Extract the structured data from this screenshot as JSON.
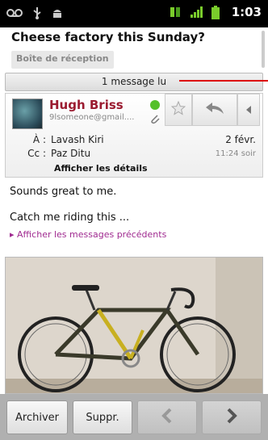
{
  "status_bar": {
    "time": "1:03",
    "left_icons": [
      "voicemail-icon",
      "usb-icon",
      "android-icon"
    ],
    "right_icons": [
      "data-sync-icon",
      "signal-icon",
      "battery-icon"
    ]
  },
  "header": {
    "subject": "Cheese factory this Sunday?",
    "label": "Boîte de réception"
  },
  "read_bar": {
    "text": "1 message lu"
  },
  "message": {
    "sender_name": "Hugh Briss",
    "sender_email": "9lsomeone@gmail....",
    "to_label": "À :",
    "to_value": "Lavash Kiri",
    "cc_label": "Cc :",
    "cc_value": "Paz Ditu",
    "date": "2 févr.",
    "time": "11:24 soir",
    "details_link": "Afficher les détails",
    "presence_color": "#55c02a",
    "body_line1": "Sounds great to me.",
    "body_line2": "Catch me riding this ...",
    "show_previous": "▸ Afficher les messages précédents"
  },
  "bottom_bar": {
    "archive_label": "Archiver",
    "delete_label": "Suppr."
  },
  "colors": {
    "sender": "#9b1b30",
    "link": "#a02a90",
    "status_bar": "#000000"
  }
}
